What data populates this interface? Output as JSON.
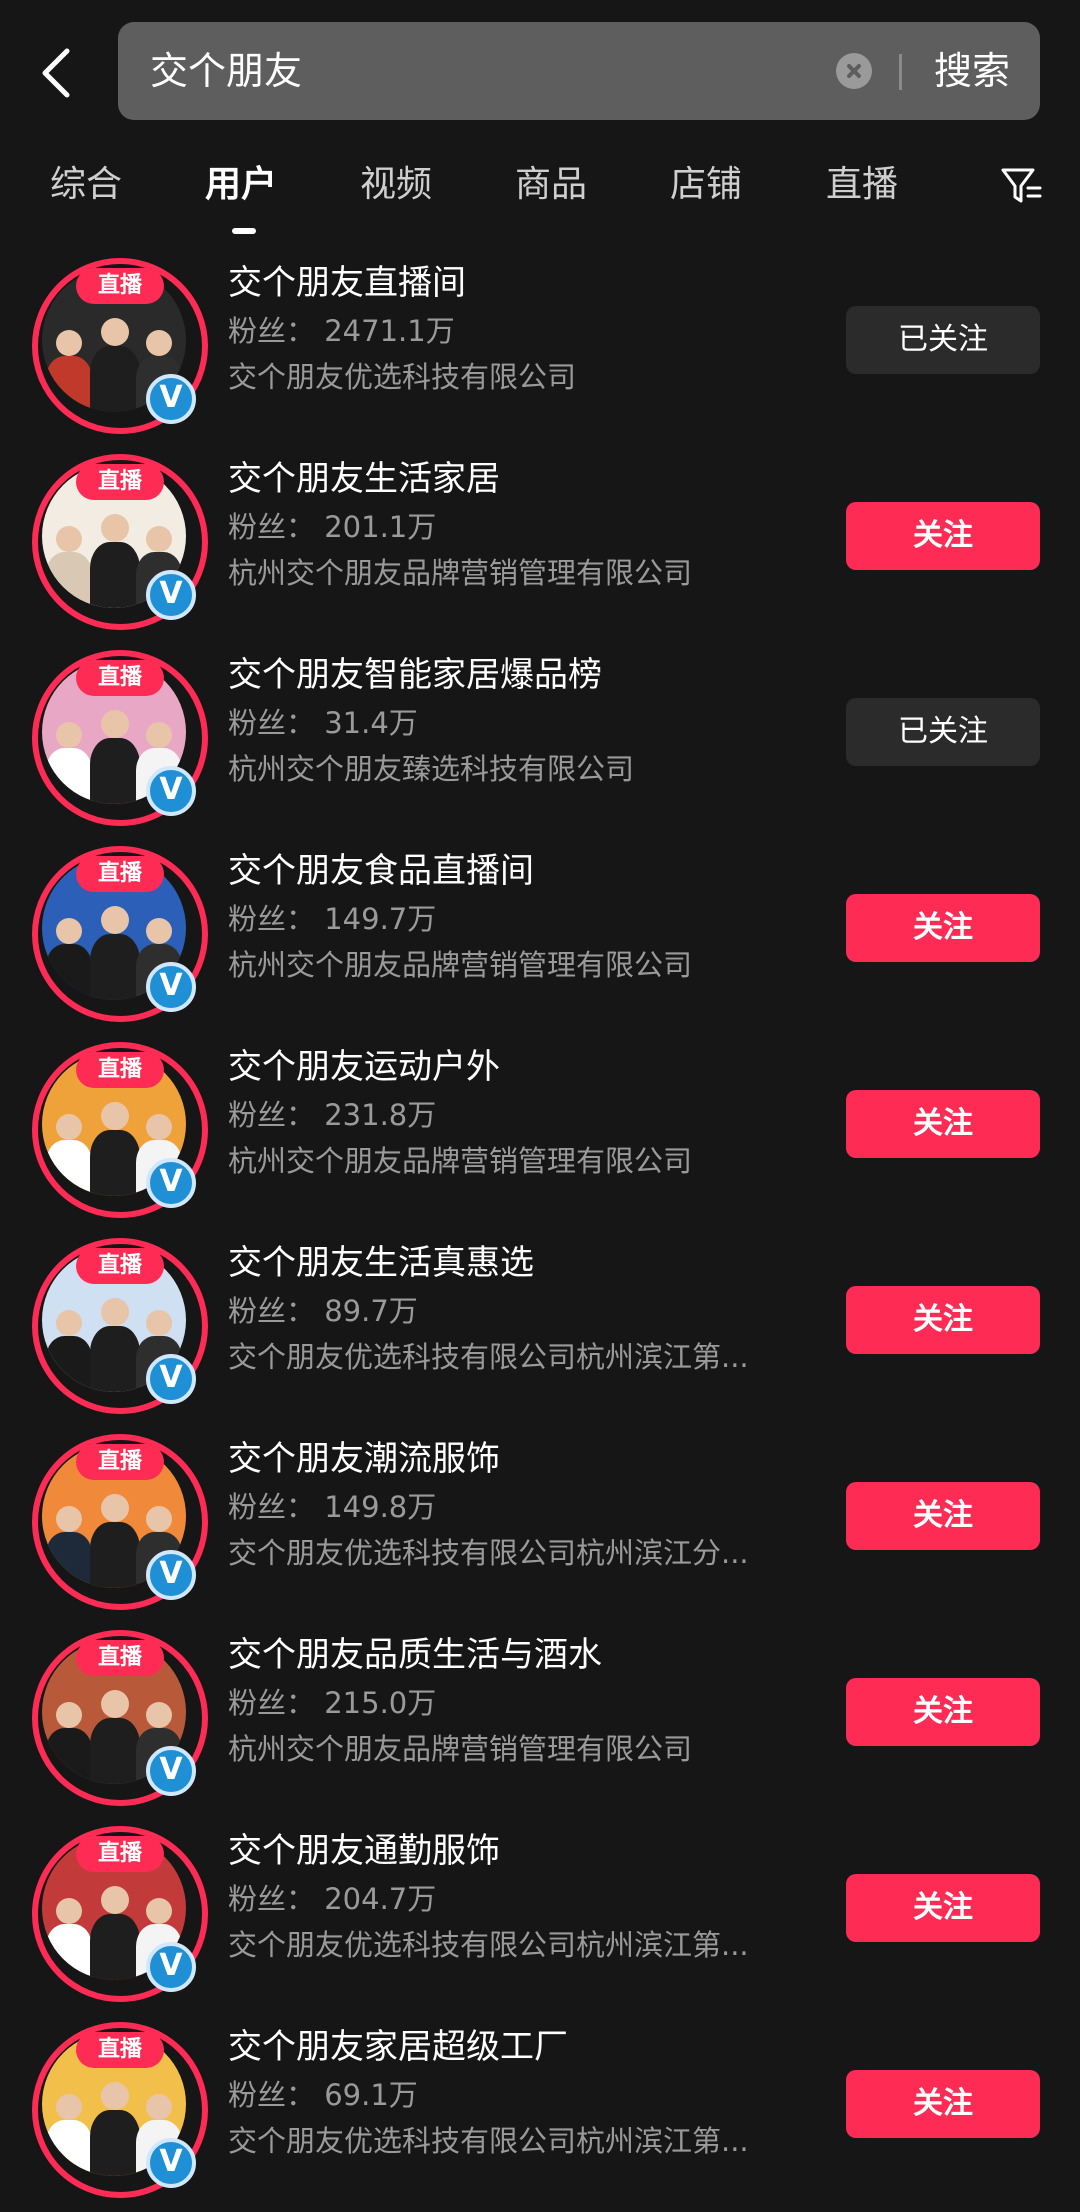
{
  "search": {
    "query": "交个朋友",
    "button_label": "搜索"
  },
  "tabs": [
    {
      "label": "综合"
    },
    {
      "label": "用户"
    },
    {
      "label": "视频"
    },
    {
      "label": "商品"
    },
    {
      "label": "店铺"
    },
    {
      "label": "直播"
    }
  ],
  "active_tab": "用户",
  "live_badge_label": "直播",
  "results": [
    {
      "name": "交个朋友直播间",
      "fans": "粉丝： 2471.1万",
      "company": "交个朋友优选科技有限公司",
      "button": "已关注",
      "followed": true,
      "bg": "#2a2a2a",
      "accent": "#c0392b"
    },
    {
      "name": "交个朋友生活家居",
      "fans": "粉丝： 201.1万",
      "company": "杭州交个朋友品牌营销管理有限公司",
      "button": "关注",
      "followed": false,
      "bg": "#f2ece2",
      "accent": "#d9c9b4"
    },
    {
      "name": "交个朋友智能家居爆品榜",
      "fans": "粉丝： 31.4万",
      "company": "杭州交个朋友臻选科技有限公司",
      "button": "已关注",
      "followed": true,
      "bg": "#e9a7c6",
      "accent": "#ffffff"
    },
    {
      "name": "交个朋友食品直播间",
      "fans": "粉丝： 149.7万",
      "company": "杭州交个朋友品牌营销管理有限公司",
      "button": "关注",
      "followed": false,
      "bg": "#2b5fb8",
      "accent": "#1a1a1a"
    },
    {
      "name": "交个朋友运动户外",
      "fans": "粉丝： 231.8万",
      "company": "杭州交个朋友品牌营销管理有限公司",
      "button": "关注",
      "followed": false,
      "bg": "#f0a23a",
      "accent": "#ffffff"
    },
    {
      "name": "交个朋友生活真惠选",
      "fans": "粉丝： 89.7万",
      "company": "交个朋友优选科技有限公司杭州滨江第...",
      "button": "关注",
      "followed": false,
      "bg": "#cfe0f2",
      "accent": "#1a1a1a"
    },
    {
      "name": "交个朋友潮流服饰",
      "fans": "粉丝： 149.8万",
      "company": "交个朋友优选科技有限公司杭州滨江分...",
      "button": "关注",
      "followed": false,
      "bg": "#f08a3a",
      "accent": "#1e2a3a"
    },
    {
      "name": "交个朋友品质生活与酒水",
      "fans": "粉丝： 215.0万",
      "company": "杭州交个朋友品牌营销管理有限公司",
      "button": "关注",
      "followed": false,
      "bg": "#b85a3a",
      "accent": "#1a1a1a"
    },
    {
      "name": "交个朋友通勤服饰",
      "fans": "粉丝： 204.7万",
      "company": "交个朋友优选科技有限公司杭州滨江第...",
      "button": "关注",
      "followed": false,
      "bg": "#c23a3a",
      "accent": "#ffffff"
    },
    {
      "name": "交个朋友家居超级工厂",
      "fans": "粉丝： 69.1万",
      "company": "交个朋友优选科技有限公司杭州滨江第...",
      "button": "关注",
      "followed": false,
      "bg": "#f2c04a",
      "accent": "#ffffff"
    }
  ],
  "colors": {
    "accent": "#fe2c55",
    "background": "#161616",
    "followed_button": "#2b2b2b"
  }
}
